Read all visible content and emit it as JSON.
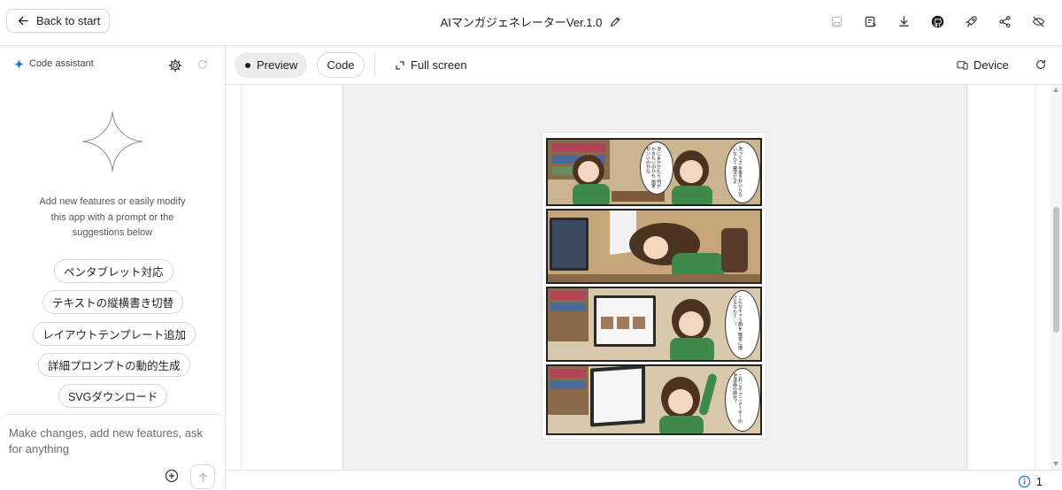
{
  "header": {
    "back_label": "Back to start",
    "title": "AIマンガジェネレーターVer.1.0",
    "icons": [
      "save-icon",
      "save-as-icon",
      "download-icon",
      "github-icon",
      "deploy-rocket-icon",
      "share-icon",
      "hide-panel-icon"
    ]
  },
  "assistant": {
    "title": "Code assistant",
    "intro": "Add new features or easily modify this app with a prompt or the suggestions below",
    "suggestions": [
      "ペンタブレット対応",
      "テキストの縦横書き切替",
      "レイアウトテンプレート追加",
      "詳細プロンプトの動的生成",
      "SVGダウンロード"
    ],
    "input_placeholder": "Make changes, add new features, ask for anything"
  },
  "toolbar": {
    "preview_label": "Preview",
    "code_label": "Code",
    "fullscreen_label": "Full screen",
    "device_label": "Device"
  },
  "manga": {
    "panel1_bubble_right": "AIってさ 手書きがいらないなんて 魔法だよ",
    "panel1_bubble_left": "AIにまかせたら 何がかきたいのかも 画家がいいのかな",
    "panel3_bubble": "こんなキャラ顔を 簡単に描けるなんて…！",
    "panel4_bubble": "これこそ アニメーターの AI漫画の時代！"
  },
  "status": {
    "issues_count": "1"
  },
  "colors": {
    "accent_blue": "#1a73e8",
    "border": "#e3e3e3",
    "active_tab_bg": "#ececec"
  }
}
